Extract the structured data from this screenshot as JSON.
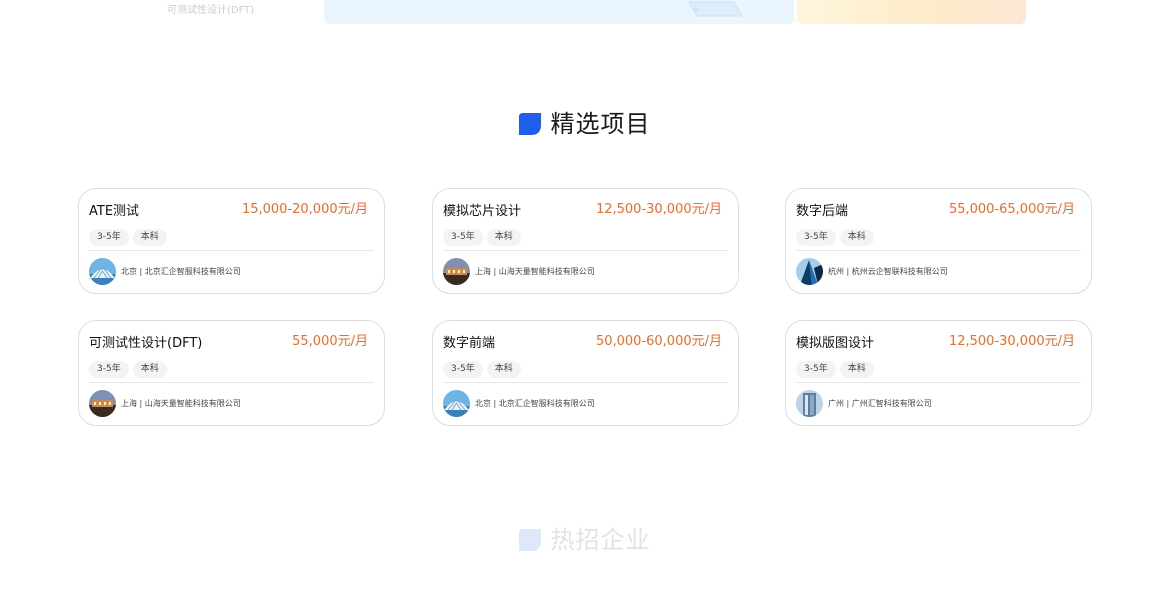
{
  "top": {
    "caption": "可测试性设计(DFT)"
  },
  "featured": {
    "title": "精选项目"
  },
  "hot": {
    "title": "热招企业"
  },
  "jobs": [
    {
      "title": "ATE测试",
      "salary": "15,000-20,000元/月",
      "experience": "3-5年",
      "education": "本科",
      "company": "北京 | 北京汇企智服科技有限公司",
      "avatar": "dome-icon"
    },
    {
      "title": "模拟芯片设计",
      "salary": "12,500-30,000元/月",
      "experience": "3-5年",
      "education": "本科",
      "company": "上海 | 山海天量智能科技有限公司",
      "avatar": "building-icon"
    },
    {
      "title": "数字后端",
      "salary": "55,000-65,000元/月",
      "experience": "3-5年",
      "education": "本科",
      "company": "杭州 | 杭州云企智联科技有限公司",
      "avatar": "skyscraper-icon"
    },
    {
      "title": "可测试性设计(DFT)",
      "salary": "55,000元/月",
      "experience": "3-5年",
      "education": "本科",
      "company": "上海 | 山海天量智能科技有限公司",
      "avatar": "building-icon"
    },
    {
      "title": "数字前端",
      "salary": "50,000-60,000元/月",
      "experience": "3-5年",
      "education": "本科",
      "company": "北京 | 北京汇企智服科技有限公司",
      "avatar": "dome-icon"
    },
    {
      "title": "模拟版图设计",
      "salary": "12,500-30,000元/月",
      "experience": "3-5年",
      "education": "本科",
      "company": "广州 | 广州汇智科技有限公司",
      "avatar": "glass-tower-icon"
    }
  ],
  "colors": {
    "accent": "#1f5eea",
    "salary": "#ee6a2c",
    "accent_faded": "#dfe7fb"
  }
}
